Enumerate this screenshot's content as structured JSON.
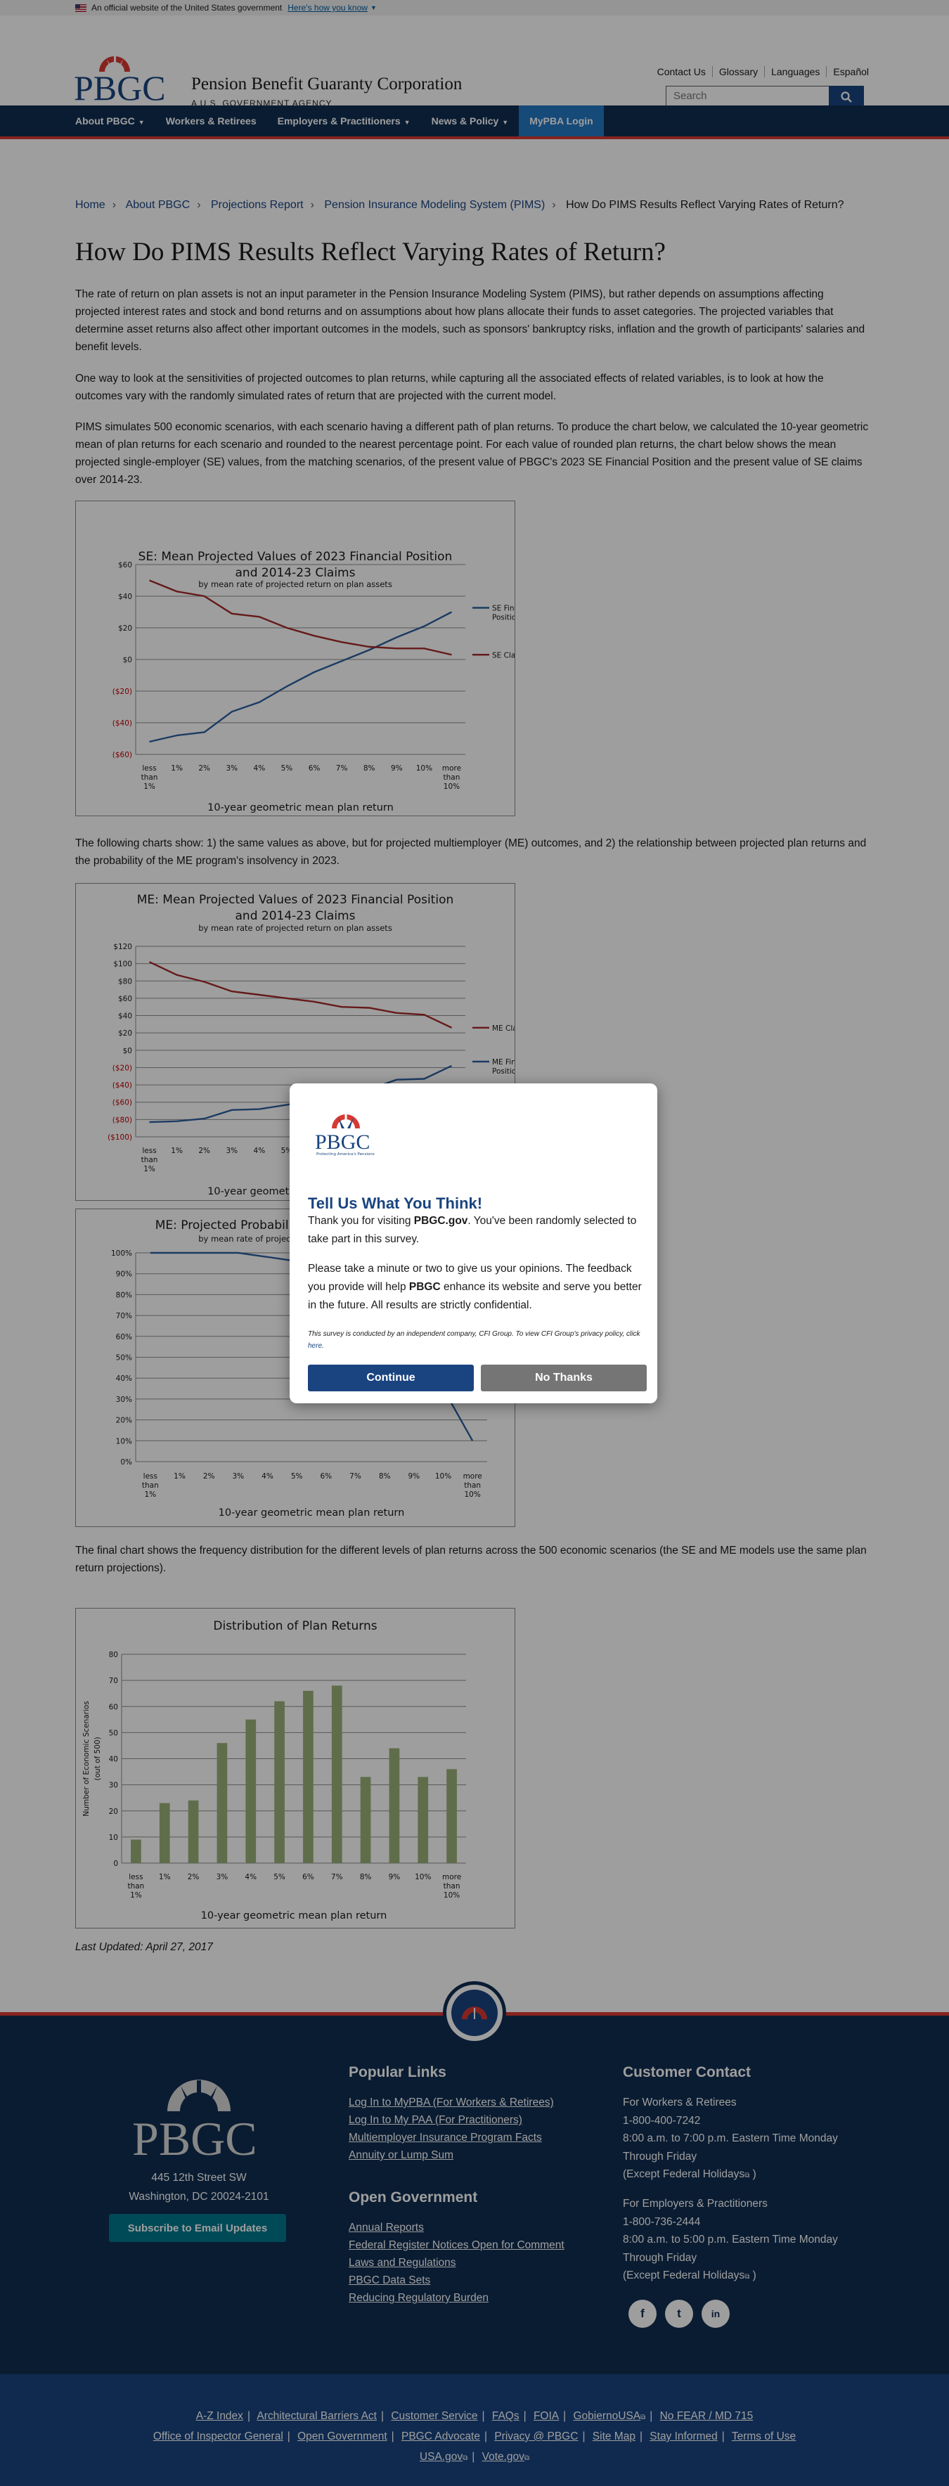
{
  "gov_banner": {
    "text": "An official website of the United States government",
    "link": "Here's how you know"
  },
  "header": {
    "logo_text": "PBGC",
    "agency_name": "Pension Benefit Guaranty Corporation",
    "agency_sub": "A U.S. GOVERNMENT AGENCY",
    "utility_links": [
      "Contact Us",
      "Glossary",
      "Languages",
      "Español"
    ],
    "search_placeholder": "Search"
  },
  "nav": {
    "items": [
      {
        "label": "About PBGC",
        "has_menu": true
      },
      {
        "label": "Workers & Retirees",
        "has_menu": false
      },
      {
        "label": "Employers & Practitioners",
        "has_menu": true
      },
      {
        "label": "News & Policy",
        "has_menu": true
      },
      {
        "label": "MyPBA Login",
        "has_menu": false
      }
    ]
  },
  "breadcrumb": [
    "Home",
    "About PBGC",
    "Projections Report",
    "Pension Insurance Modeling System (PIMS)",
    "How Do PIMS Results Reflect Varying Rates of Return?"
  ],
  "page_title": "How Do PIMS Results Reflect Varying Rates of Return?",
  "paragraphs": {
    "p1": "The rate of return on plan assets is not an input parameter in the Pension Insurance Modeling System (PIMS), but rather depends on assumptions affecting projected interest rates and stock and bond returns and on assumptions about how plans allocate their funds to asset categories. The projected variables that determine asset returns also affect other important outcomes in the models, such as sponsors' bankruptcy risks, inflation and the growth of participants' salaries and benefit levels.",
    "p2": "One way to look at the sensitivities of projected outcomes to plan returns, while capturing all the associated effects of related variables, is to look at how the outcomes vary with the randomly simulated rates of return that are projected with the current model.",
    "p3": "PIMS simulates 500 economic scenarios, with each scenario having a different path of plan returns. To produce the chart below, we calculated the 10-year geometric mean of plan returns for each scenario and rounded to the nearest percentage point. For each value of rounded plan returns, the chart below shows the mean projected single-employer (SE) values, from the matching scenarios, of the present value of PBGC's 2023 SE Financial Position and the present value of SE claims over 2014-23.",
    "p4": "The following charts show: 1) the same values as above, but for projected multiemployer (ME) outcomes, and 2) the relationship between projected plan returns and the probability of the ME program's insolvency in 2023.",
    "p5": "The final chart shows the frequency distribution for the different levels of plan returns across the 500 economic scenarios (the SE and ME models use the same plan return projections)."
  },
  "x_categories": [
    "less than 1%",
    "1%",
    "2%",
    "3%",
    "4%",
    "5%",
    "6%",
    "7%",
    "8%",
    "9%",
    "10%",
    "more than 10%"
  ],
  "chart_data": [
    {
      "type": "line",
      "title": "SE: Mean Projected Values of 2023 Financial Position and 2014-23 Claims",
      "subtitle": "by mean rate of projected return on plan assets",
      "xlabel": "10-year geometric mean plan return",
      "ylim": [
        -60,
        60
      ],
      "yticks": [
        "$60",
        "$40",
        "$20",
        "$0",
        "($20)",
        "($40)",
        "($60)"
      ],
      "series": [
        {
          "name": "SE Financial Position (PV)",
          "color": "#2e5f9e",
          "values": [
            -52,
            -48,
            -46,
            -33,
            -27,
            -17,
            -8,
            -1,
            6,
            14,
            21,
            30
          ]
        },
        {
          "name": "SE Claims (PV)",
          "color": "#a52a2a",
          "values": [
            50,
            43,
            40,
            29,
            27,
            20,
            15,
            11,
            8,
            7,
            7,
            3
          ]
        }
      ],
      "grid": true,
      "legend": "right"
    },
    {
      "type": "line",
      "title": "ME: Mean Projected Values of 2023 Financial Position and 2014-23 Claims",
      "subtitle": "by mean rate of projected return on plan assets",
      "xlabel": "10-year geometric mean plan return",
      "ylim": [
        -100,
        120
      ],
      "yticks": [
        "$120",
        "$100",
        "$80",
        "$60",
        "$40",
        "$20",
        "$0",
        "($20)",
        "($40)",
        "($60)",
        "($80)",
        "($100)"
      ],
      "series": [
        {
          "name": "ME Financial Position (PV)",
          "color": "#2e5f9e",
          "values": [
            -83,
            -82,
            -79,
            -69,
            -68,
            -63,
            -57,
            -50,
            -45,
            -34,
            -33,
            -18
          ]
        },
        {
          "name": "ME Claims (PV)",
          "color": "#a52a2a",
          "values": [
            102,
            87,
            79,
            68,
            64,
            60,
            56,
            50,
            49,
            43,
            41,
            26
          ]
        }
      ],
      "grid": true,
      "legend": "right"
    },
    {
      "type": "line",
      "title": "ME: Projected Probability of Insolvency in 2023",
      "subtitle": "by mean rate of projected return on plan assets",
      "xlabel": "10-year geometric mean plan return",
      "ylim": [
        0,
        100
      ],
      "yticks": [
        "100%",
        "90%",
        "80%",
        "70%",
        "60%",
        "50%",
        "40%",
        "30%",
        "20%",
        "10%",
        "0%"
      ],
      "series": [
        {
          "name": "",
          "color": "#2e5f9e",
          "values": [
            100,
            100,
            100,
            100,
            98,
            96,
            92,
            86,
            74,
            56,
            35,
            10
          ]
        }
      ],
      "grid": true,
      "legend": "none"
    },
    {
      "type": "bar",
      "title": "Distribution of Plan Returns",
      "xlabel": "10-year geometric mean plan return",
      "ylabel": "Number of Economic Scenarios (out of 500)",
      "ylim": [
        0,
        80
      ],
      "yticks": [
        "80",
        "70",
        "60",
        "50",
        "40",
        "30",
        "20",
        "10",
        "0"
      ],
      "categories": [
        "less than 1%",
        "1%",
        "2%",
        "3%",
        "4%",
        "5%",
        "6%",
        "7%",
        "8%",
        "9%",
        "10%",
        "more than 10%"
      ],
      "values": [
        9,
        23,
        24,
        46,
        55,
        62,
        66,
        68,
        33,
        44,
        33,
        36
      ],
      "bar_color": "#9bb07a",
      "grid": true
    }
  ],
  "last_updated": "Last Updated: April 27, 2017",
  "footer": {
    "logo_text": "PBGC",
    "address_line1": "445 12th Street SW",
    "address_line2": "Washington, DC 20024-2101",
    "subscribe": "Subscribe to Email Updates",
    "popular_links_title": "Popular Links",
    "popular_links": [
      "Log In to MyPBA (For Workers & Retirees)",
      "Log In to My PAA (For Practitioners)",
      "Multiemployer Insurance Program Facts",
      "Annuity or Lump Sum"
    ],
    "open_gov_title": "Open Government",
    "open_gov_links": [
      "Annual Reports",
      "Federal Register Notices Open for Comment",
      "Laws and Regulations",
      "PBGC Data Sets",
      "Reducing Regulatory Burden"
    ],
    "contact_title": "Customer Contact",
    "workers_label": "For Workers & Retirees",
    "workers_phone": "1-800-400-7242",
    "workers_hours": "8:00 a.m. to 7:00 p.m. Eastern Time Monday Through Friday",
    "workers_except_prefix": "(Except",
    "holidays_link": "Federal Holidays",
    "except_suffix": ")",
    "employers_label": "For Employers & Practitioners",
    "employers_phone": "1-800-736-2444",
    "employers_hours": "8:00 a.m. to 5:00 p.m. Eastern Time Monday Through Friday",
    "employers_except_prefix": "(Except",
    "social": [
      "f",
      "t",
      "in"
    ]
  },
  "sub_footer": {
    "row1": [
      "A-Z Index",
      "Architectural Barriers Act",
      "Customer Service",
      "FAQs",
      "FOIA",
      "GobiernoUSA",
      "No FEAR / MD 715"
    ],
    "row2": [
      "Office of Inspector General",
      "Open Government",
      "PBGC Advocate",
      "Privacy @ PBGC",
      "Site Map",
      "Stay Informed",
      "Terms of Use"
    ],
    "row3": [
      "USA.gov",
      "Vote.gov"
    ]
  },
  "modal": {
    "logo_text": "PBGC",
    "logo_tagline": "Protecting America's Pensions",
    "title": "Tell Us What You Think!",
    "text1_a": "Thank you for visiting ",
    "text1_b": "PBGC.gov",
    "text1_c": ". You've been randomly selected to take part in this survey.",
    "text2_a": "Please take a minute or two to give us your opinions. The feedback you provide will help ",
    "text2_b": "PBGC",
    "text2_c": " enhance its website and serve you better in the future. All results are strictly confidential.",
    "fine": "This survey is conducted by an independent company, CFI Group. To view CFI Group's privacy policy, click ",
    "fine_link": "here",
    "continue": "Continue",
    "no_thanks": "No Thanks"
  }
}
